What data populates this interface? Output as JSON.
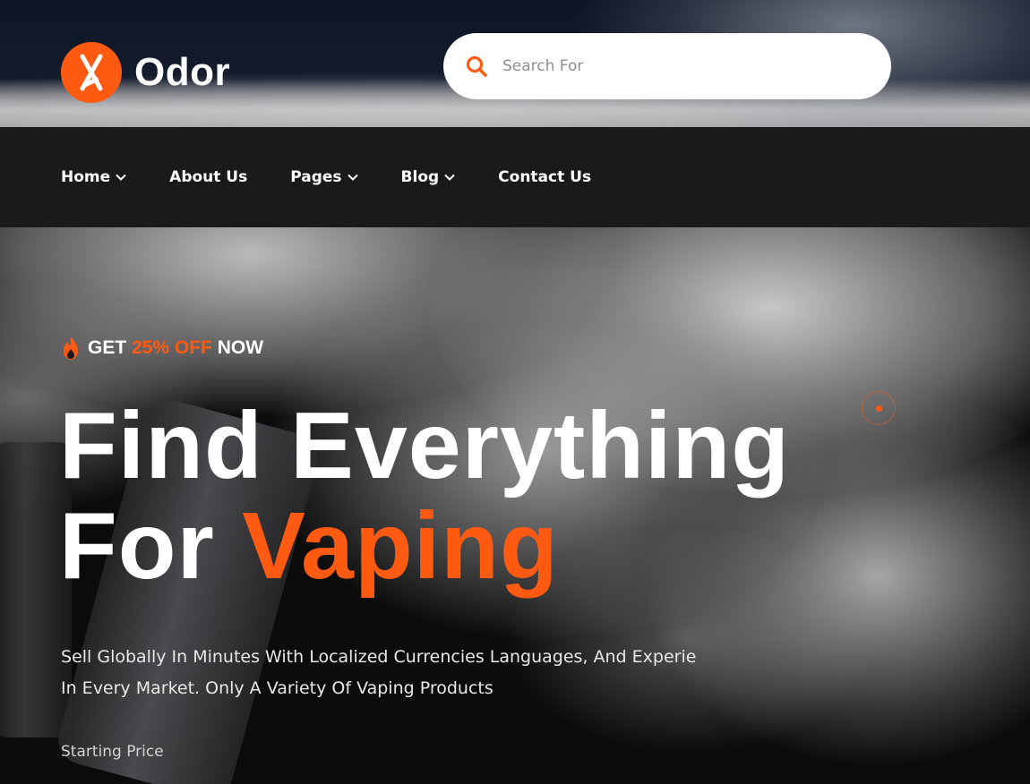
{
  "brand": {
    "name": "Odor",
    "accent": "#ff5a11"
  },
  "search": {
    "placeholder": "Search For",
    "icon": "search-icon"
  },
  "nav": [
    {
      "label": "Home",
      "has_dropdown": true
    },
    {
      "label": "About Us",
      "has_dropdown": false
    },
    {
      "label": "Pages",
      "has_dropdown": true
    },
    {
      "label": "Blog",
      "has_dropdown": true
    },
    {
      "label": "Contact Us",
      "has_dropdown": false
    }
  ],
  "hero": {
    "badge": {
      "icon": "fire-icon",
      "part1": "GET",
      "part2": "25% OFF",
      "part3": "NOW"
    },
    "headline_line1": "Find Everything",
    "headline_line2_prefix": "For",
    "headline_line2_accent": "Vaping",
    "description": "Sell Globally In Minutes With Localized Currencies Languages, And Experie In Every Market. Only A Variety Of Vaping Products",
    "price_label": "Starting Price"
  }
}
